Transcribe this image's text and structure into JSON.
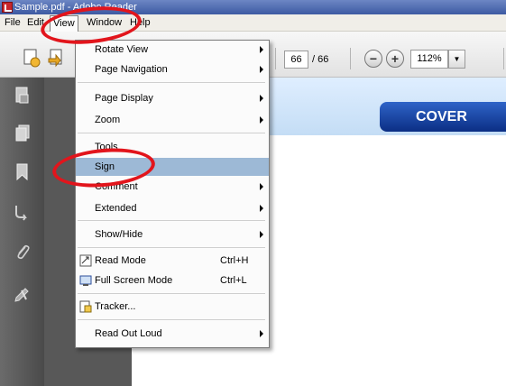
{
  "window": {
    "title": "Sample.pdf - Adobe Reader"
  },
  "menubar": [
    {
      "label": "File",
      "key": "F"
    },
    {
      "label": "Edit",
      "key": "E"
    },
    {
      "label": "View",
      "key": "V"
    },
    {
      "label": "Window",
      "key": "W"
    },
    {
      "label": "Help",
      "key": "H"
    }
  ],
  "toolbar": {
    "current_page": "66",
    "total_pages": "/ 66",
    "zoom": "112%"
  },
  "view_menu": [
    {
      "label": "Rotate View",
      "submenu": true
    },
    {
      "label": "Page Navigation",
      "submenu": true
    },
    {
      "label": "Page Display",
      "submenu": true
    },
    {
      "label": "Zoom",
      "submenu": true
    },
    {
      "label": "Tools"
    },
    {
      "label": "Sign",
      "highlighted": true
    },
    {
      "label": "Comment",
      "submenu": true
    },
    {
      "label": "Extended",
      "submenu": true
    },
    {
      "label": "Show/Hide",
      "submenu": true
    },
    {
      "label": "Read Mode",
      "shortcut": "Ctrl+H",
      "icon": "read-mode-icon"
    },
    {
      "label": "Full Screen Mode",
      "shortcut": "Ctrl+L",
      "icon": "full-screen-icon"
    },
    {
      "label": "Tracker...",
      "icon": "tracker-icon"
    },
    {
      "label": "Read Out Loud",
      "submenu": true
    }
  ],
  "document": {
    "banner_label": "COVER"
  },
  "colors": {
    "highlight": "#9db9d6",
    "annotation": "#e2151c",
    "banner": "#0b2e84"
  }
}
